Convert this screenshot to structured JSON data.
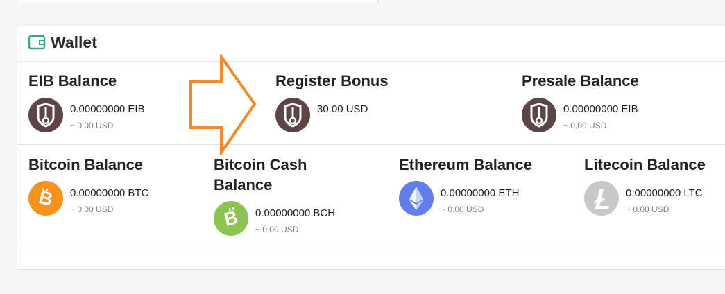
{
  "wallet": {
    "title": "Wallet",
    "icon": "wallet-icon",
    "accent": "#3aa592"
  },
  "balances_row1": [
    {
      "title": "EIB Balance",
      "amount": "0.00000000 EIB",
      "usd": "~ 0.00 USD",
      "icon": "eib-coin-icon",
      "color": "#5e4545"
    },
    {
      "title": "Register Bonus",
      "amount": "30.00 USD",
      "usd": "",
      "icon": "eib-coin-icon",
      "color": "#5e4545"
    },
    {
      "title": "Presale Balance",
      "amount": "0.00000000 EIB",
      "usd": "~ 0.00 USD",
      "icon": "eib-coin-icon",
      "color": "#5e4545"
    }
  ],
  "balances_row2": [
    {
      "title": "Bitcoin Balance",
      "amount": "0.00000000 BTC",
      "usd": "~ 0.00 USD",
      "icon": "bitcoin-icon",
      "color": "#f7931a"
    },
    {
      "title_line1": "Bitcoin Cash",
      "title_line2": "Balance",
      "amount": "0.00000000 BCH",
      "usd": "~ 0.00 USD",
      "icon": "bitcoin-cash-icon",
      "color": "#8dc351"
    },
    {
      "title": "Ethereum Balance",
      "amount": "0.00000000 ETH",
      "usd": "~ 0.00 USD",
      "icon": "ethereum-icon",
      "color": "#627eea"
    },
    {
      "title": "Litecoin Balance",
      "amount": "0.00000000 LTC",
      "usd": "~ 0.00 USD",
      "icon": "litecoin-icon",
      "color": "#c8c8c8"
    }
  ],
  "annotation": {
    "icon": "arrow-right-icon",
    "color": "#f08a30"
  }
}
